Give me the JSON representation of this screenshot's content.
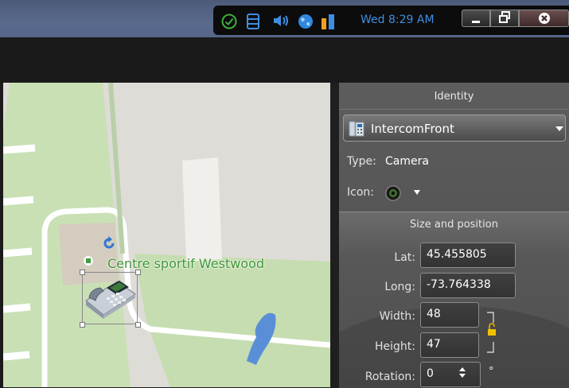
{
  "tray": {
    "time": "Wed 8:29 AM",
    "icons": [
      "check-circle-icon",
      "database-icon",
      "speaker-icon",
      "globe-icon",
      "signal-bars-icon"
    ],
    "window_buttons": [
      "minimize-icon",
      "restore-icon",
      "close-icon"
    ]
  },
  "map": {
    "place_label": "Centre sportif Westwood",
    "icons": [
      "refresh-icon",
      "phone-icon"
    ]
  },
  "panel": {
    "identity_header": "Identity",
    "entity_name": "IntercomFront",
    "type_label": "Type:",
    "type_value": "Camera",
    "icon_label": "Icon:",
    "size_header": "Size and position",
    "lat_label": "Lat:",
    "lat_value": "45.455805",
    "long_label": "Long:",
    "long_value": "-73.764338",
    "width_label": "Width:",
    "width_value": "48",
    "height_label": "Height:",
    "height_value": "47",
    "rotation_label": "Rotation:",
    "rotation_value": "0",
    "degree": "°"
  },
  "colors": {
    "accent_blue": "#3d8ee0",
    "map_park_green": "#c5dfb3",
    "map_label_green": "#3e9636",
    "panel_gray": "#5a5a5a",
    "water_blue": "#5a8fd8"
  }
}
